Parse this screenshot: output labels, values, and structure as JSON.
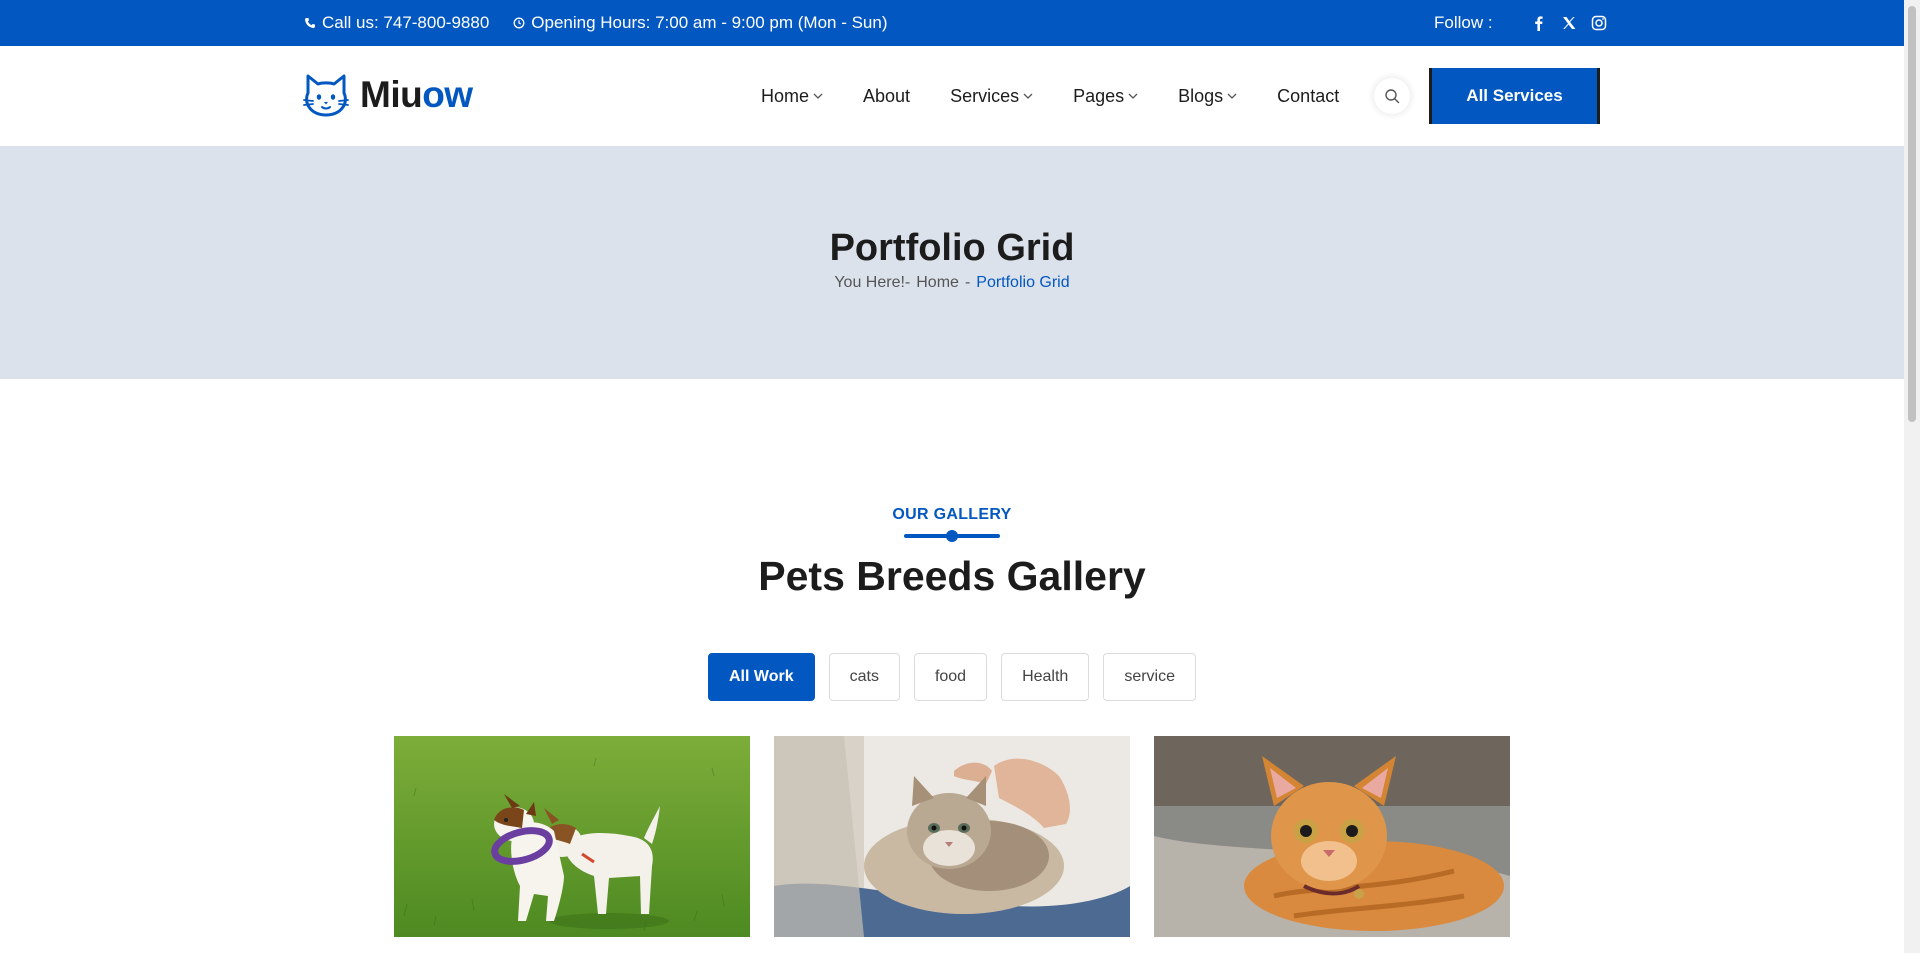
{
  "topbar": {
    "phone": "Call us: 747-800-9880",
    "hours": "Opening Hours: 7:00 am - 9:00 pm (Mon - Sun)",
    "follow_label": "Follow :",
    "social": [
      "facebook-icon",
      "x-icon",
      "instagram-icon"
    ]
  },
  "header": {
    "logo_prefix": "Miu",
    "logo_suffix": "ow",
    "nav": [
      {
        "label": "Home",
        "dropdown": true
      },
      {
        "label": "About",
        "dropdown": false
      },
      {
        "label": "Services",
        "dropdown": true
      },
      {
        "label": "Pages",
        "dropdown": true
      },
      {
        "label": "Blogs",
        "dropdown": true
      },
      {
        "label": "Contact",
        "dropdown": false
      }
    ],
    "cta": "All Services"
  },
  "banner": {
    "title": "Portfolio Grid",
    "crumb_prefix": "You Here!-",
    "crumb_home": "Home",
    "crumb_sep": "-",
    "crumb_current": "Portfolio Grid"
  },
  "gallery": {
    "subtitle": "OUR GALLERY",
    "heading": "Pets Breeds Gallery",
    "filters": [
      "All Work",
      "cats",
      "food",
      "Health",
      "service"
    ],
    "active_filter": "All Work"
  },
  "colors": {
    "brand": "#0257c0",
    "banner_bg": "#dbe2ec",
    "text": "#1c1c1c"
  }
}
